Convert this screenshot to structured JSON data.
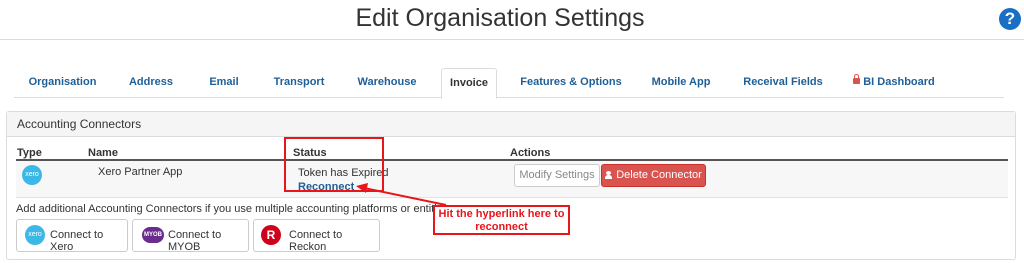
{
  "header": {
    "title": "Edit Organisation Settings",
    "help_label": "?"
  },
  "tabs": [
    {
      "label": "Organisation"
    },
    {
      "label": "Address"
    },
    {
      "label": "Email"
    },
    {
      "label": "Transport"
    },
    {
      "label": "Warehouse"
    },
    {
      "label": "Invoice",
      "active": true
    },
    {
      "label": "Features & Options"
    },
    {
      "label": "Mobile App"
    },
    {
      "label": "Receival Fields"
    },
    {
      "label": "BI Dashboard",
      "icon": "lock-icon"
    }
  ],
  "panel": {
    "title": "Accounting Connectors",
    "columns": {
      "type": "Type",
      "name": "Name",
      "status": "Status",
      "actions": "Actions"
    },
    "row": {
      "type_logo": "xero",
      "name": "Xero Partner App",
      "status": "Token has Expired",
      "reconnect_label": "Reconnect",
      "modify_label": "Modify Settings",
      "delete_label": "Delete Connector"
    },
    "hint": "Add additional Accounting Connectors if you use multiple accounting platforms or entities.",
    "connect_buttons": {
      "xero": "Connect to Xero",
      "myob": "Connect to MYOB",
      "reckon": "Connect to Reckon"
    },
    "logo_text": {
      "xero": "xero",
      "myob": "MYOB",
      "reckon": "R"
    }
  },
  "annotation": {
    "text": "Hit the hyperlink here to reconnect",
    "color": "#e8151b"
  }
}
